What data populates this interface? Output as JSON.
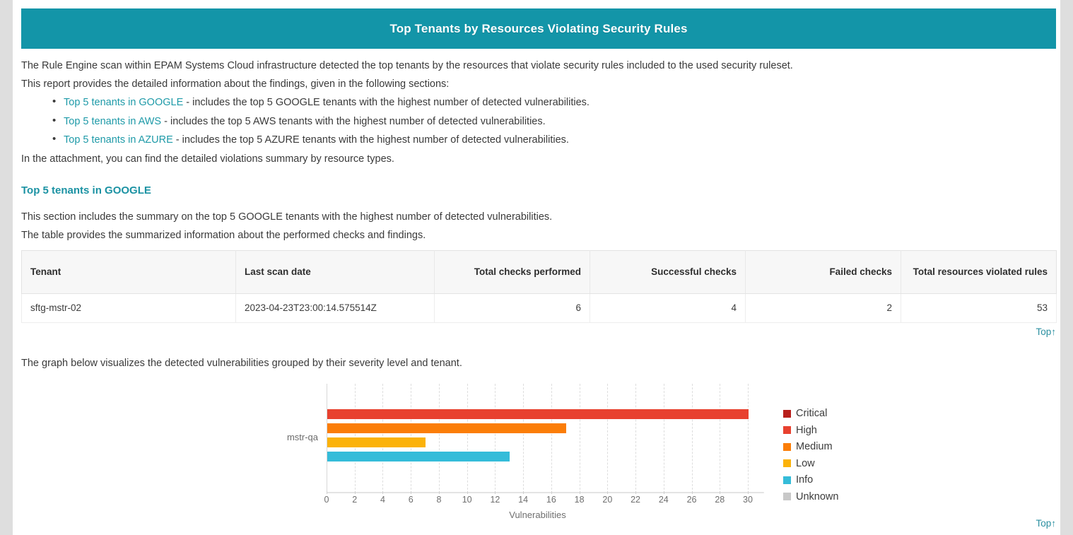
{
  "banner": {
    "title": "Top Tenants by Resources Violating Security Rules",
    "background_color": "#1395a8"
  },
  "intro": {
    "line1": "The Rule Engine scan within EPAM Systems Cloud infrastructure detected the top tenants by the resources that violate security rules included to the used security ruleset.",
    "line2": "This report provides the detailed information about the findings, given in the following sections:",
    "bullets": [
      {
        "link": "Top 5 tenants in GOOGLE",
        "rest": " - includes the top 5 GOOGLE tenants with the highest number of detected vulnerabilities."
      },
      {
        "link": "Top 5 tenants in AWS",
        "rest": " - includes the top 5 AWS tenants with the highest number of detected vulnerabilities."
      },
      {
        "link": "Top 5 tenants in AZURE",
        "rest": " - includes the top 5 AZURE tenants with the highest number of detected vulnerabilities."
      }
    ],
    "attachment_note": "In the attachment, you can find the detailed violations summary by resource types."
  },
  "section": {
    "heading": "Top 5 tenants in GOOGLE",
    "desc1": "This section includes the summary on the top 5 GOOGLE tenants with the highest number of detected vulnerabilities.",
    "desc2": "The table provides the summarized information about the performed checks and findings.",
    "graph_desc": "The graph below visualizes the detected vulnerabilities grouped by their severity level and tenant.",
    "link_color": "#1b92a3"
  },
  "table": {
    "headers": [
      "Tenant",
      "Last scan date",
      "Total checks performed",
      "Successful checks",
      "Failed checks",
      "Total resources violated rules"
    ],
    "rows": [
      {
        "tenant": "sftg-mstr-02",
        "last_scan_date": "2023-04-23T23:00:14.575514Z",
        "total_checks_performed": "6",
        "successful_checks": "4",
        "failed_checks": "2",
        "total_resources_violated_rules": "53"
      }
    ]
  },
  "top_link": {
    "label": "Top↑",
    "color": "#2a8fa0"
  },
  "chart_data": {
    "type": "bar",
    "orientation": "horizontal",
    "title": "",
    "xlabel": "Vulnerabilities",
    "ylabel": "",
    "categories": [
      "mstr-qa"
    ],
    "xlim": [
      0,
      30
    ],
    "xticks": [
      0,
      2,
      4,
      6,
      8,
      10,
      12,
      14,
      16,
      18,
      20,
      22,
      24,
      26,
      28,
      30
    ],
    "grid": true,
    "legend_position": "right",
    "series": [
      {
        "name": "Critical",
        "color": "#b81f1b",
        "values": [
          0
        ]
      },
      {
        "name": "High",
        "color": "#e8412f",
        "values": [
          30
        ]
      },
      {
        "name": "Medium",
        "color": "#fb7d07",
        "values": [
          17
        ]
      },
      {
        "name": "Low",
        "color": "#fbb20a",
        "values": [
          7
        ]
      },
      {
        "name": "Info",
        "color": "#35bcd9",
        "values": [
          13
        ]
      },
      {
        "name": "Unknown",
        "color": "#c8c8c8",
        "values": [
          0
        ]
      }
    ]
  }
}
